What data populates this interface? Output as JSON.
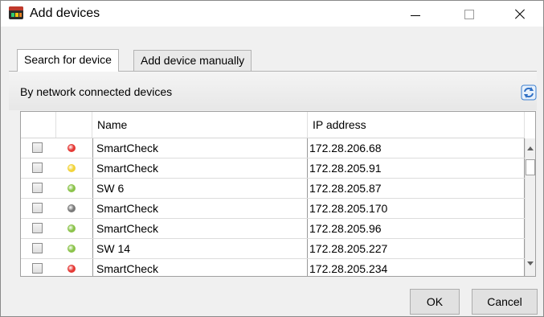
{
  "window": {
    "title": "Add devices"
  },
  "tabs": [
    {
      "label": "Search for device",
      "active": true
    },
    {
      "label": "Add device manually",
      "active": false
    }
  ],
  "section": {
    "label": "By network connected devices",
    "refresh_icon": "refresh-icon"
  },
  "table": {
    "columns": [
      "",
      "",
      "Name",
      "IP address"
    ],
    "rows": [
      {
        "checked": false,
        "status_color": "#e53935",
        "name": "SmartCheck",
        "ip": "172.28.206.68"
      },
      {
        "checked": false,
        "status_color": "#f2d43a",
        "name": "SmartCheck",
        "ip": "172.28.205.91"
      },
      {
        "checked": false,
        "status_color": "#8bc34a",
        "name": "SW 6",
        "ip": "172.28.205.87"
      },
      {
        "checked": false,
        "status_color": "#7a7a7a",
        "name": "SmartCheck",
        "ip": "172.28.205.170"
      },
      {
        "checked": false,
        "status_color": "#8bc34a",
        "name": "SmartCheck",
        "ip": "172.28.205.96"
      },
      {
        "checked": false,
        "status_color": "#8bc34a",
        "name": "SW 14",
        "ip": "172.28.205.227"
      },
      {
        "checked": false,
        "status_color": "#e53935",
        "name": "SmartCheck",
        "ip": "172.28.205.234"
      }
    ]
  },
  "buttons": {
    "ok": "OK",
    "cancel": "Cancel"
  }
}
